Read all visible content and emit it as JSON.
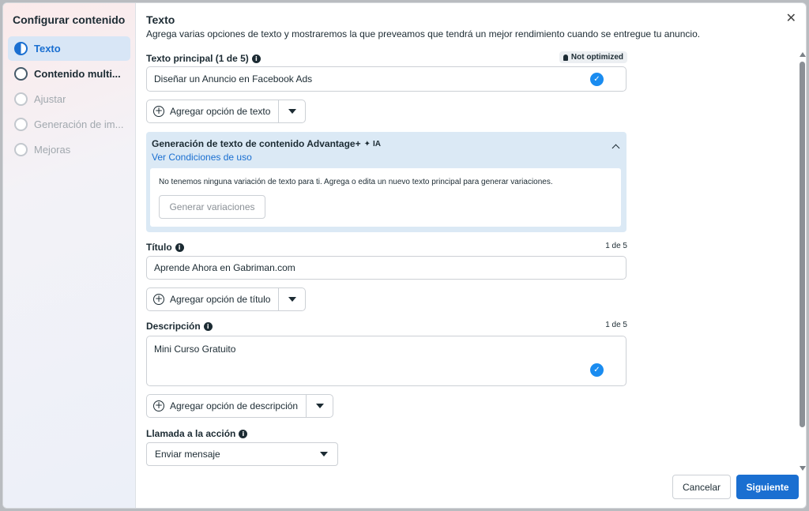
{
  "sidebar": {
    "title": "Configurar contenido",
    "steps": [
      {
        "label": "Texto",
        "state": "active"
      },
      {
        "label": "Contenido multi...",
        "state": "done"
      },
      {
        "label": "Ajustar",
        "state": "pending"
      },
      {
        "label": "Generación de im...",
        "state": "pending"
      },
      {
        "label": "Mejoras",
        "state": "pending"
      }
    ]
  },
  "header": {
    "title": "Texto",
    "subtitle": "Agrega varias opciones de texto y mostraremos la que preveamos que tendrá un mejor rendimiento cuando se entregue tu anuncio.",
    "close_glyph": "✕"
  },
  "primary_text": {
    "label": "Texto principal (1 de 5)",
    "badge": "Not optimized",
    "value": "Diseñar un Anuncio en Facebook Ads",
    "add_button": "Agregar opción de texto"
  },
  "advantage": {
    "title": "Generación de texto de contenido Advantage+",
    "ai_label": "IA",
    "terms_link": "Ver Condiciones de uso",
    "message": "No tenemos ninguna variación de texto para ti. Agrega o edita un nuevo texto principal para generar variaciones.",
    "generate_button": "Generar variaciones"
  },
  "title_field": {
    "label": "Título",
    "counter": "1 de 5",
    "value": "Aprende Ahora en Gabriman.com",
    "add_button": "Agregar opción de título"
  },
  "description": {
    "label": "Descripción",
    "counter": "1 de 5",
    "value": "Mini Curso Gratuito",
    "add_button": "Agregar opción de descripción"
  },
  "cta": {
    "label": "Llamada a la acción",
    "selected": "Enviar mensaje"
  },
  "footer": {
    "cancel": "Cancelar",
    "next": "Siguiente"
  },
  "colors": {
    "accent": "#1a6fd1",
    "check": "#1a8cf0",
    "advantage_bg": "#dbe9f5"
  }
}
